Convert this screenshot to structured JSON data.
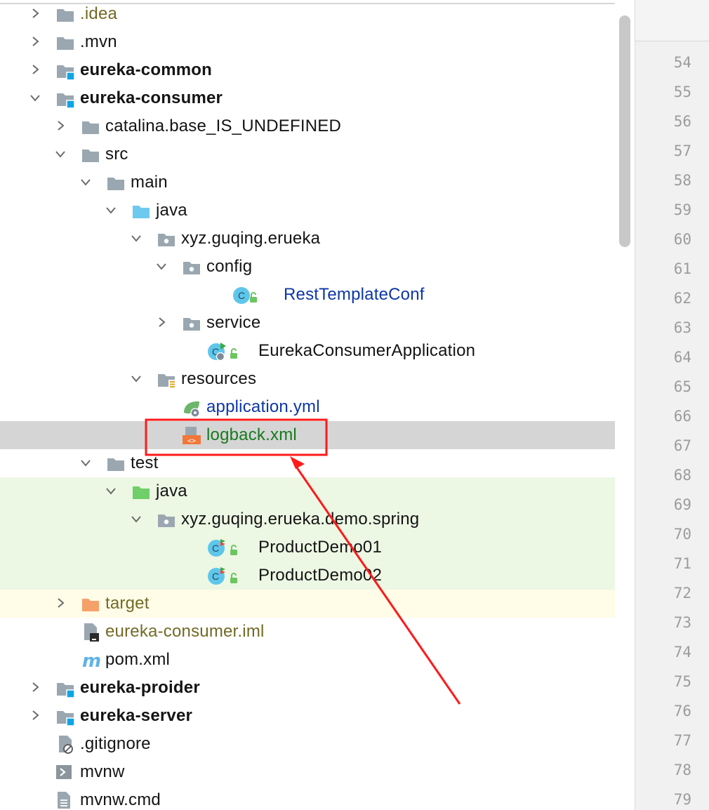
{
  "project_tree": {
    "rows": [
      {
        "label": ".idea",
        "arrow": "right",
        "icon": "folder-icon"
      },
      {
        "label": ".mvn",
        "arrow": "right",
        "icon": "folder-icon"
      },
      {
        "label": "eureka-common",
        "arrow": "right",
        "icon": "module-folder-icon"
      },
      {
        "label": "eureka-consumer",
        "arrow": "down",
        "icon": "module-folder-icon"
      },
      {
        "label": "catalina.base_IS_UNDEFINED",
        "arrow": "right",
        "icon": "folder-icon"
      },
      {
        "label": "src",
        "arrow": "down",
        "icon": "folder-icon"
      },
      {
        "label": "main",
        "arrow": "down",
        "icon": "folder-icon"
      },
      {
        "label": "java",
        "arrow": "down",
        "icon": "source-root-folder-icon"
      },
      {
        "label": "xyz.guqing.erueka",
        "arrow": "down",
        "icon": "package-icon"
      },
      {
        "label": "config",
        "arrow": "down",
        "icon": "package-icon"
      },
      {
        "label": "RestTemplateConf",
        "arrow": "none",
        "icon": "java-class-icon"
      },
      {
        "label": "service",
        "arrow": "right",
        "icon": "package-icon"
      },
      {
        "label": "EurekaConsumerApplication",
        "arrow": "none",
        "icon": "spring-boot-app-class-icon"
      },
      {
        "label": "resources",
        "arrow": "down",
        "icon": "resources-folder-icon"
      },
      {
        "label": "application.yml",
        "arrow": "none",
        "icon": "spring-config-file-icon"
      },
      {
        "label": "logback.xml",
        "arrow": "none",
        "icon": "xml-file-icon"
      },
      {
        "label": "test",
        "arrow": "down",
        "icon": "folder-icon"
      },
      {
        "label": "java",
        "arrow": "down",
        "icon": "test-root-folder-icon"
      },
      {
        "label": "xyz.guqing.erueka.demo.spring",
        "arrow": "down",
        "icon": "package-icon"
      },
      {
        "label": "ProductDemo01",
        "arrow": "none",
        "icon": "test-class-icon"
      },
      {
        "label": "ProductDemo02",
        "arrow": "none",
        "icon": "test-class-icon"
      },
      {
        "label": "target",
        "arrow": "right",
        "icon": "excluded-folder-icon"
      },
      {
        "label": "eureka-consumer.iml",
        "arrow": "none",
        "icon": "iml-file-icon"
      },
      {
        "label": "pom.xml",
        "arrow": "none",
        "icon": "maven-pom-icon"
      },
      {
        "label": "eureka-proider",
        "arrow": "right",
        "icon": "module-folder-icon"
      },
      {
        "label": "eureka-server",
        "arrow": "right",
        "icon": "module-folder-icon"
      },
      {
        "label": ".gitignore",
        "arrow": "none",
        "icon": "gitignore-file-icon"
      },
      {
        "label": "mvnw",
        "arrow": "none",
        "icon": "shell-script-icon"
      },
      {
        "label": "mvnw.cmd",
        "arrow": "none",
        "icon": "text-file-icon"
      }
    ],
    "selected_label": "logback.xml"
  },
  "gutter": {
    "line_numbers": [
      "54",
      "55",
      "56",
      "57",
      "58",
      "59",
      "60",
      "61",
      "62",
      "63",
      "64",
      "65",
      "66",
      "67",
      "68",
      "69",
      "70",
      "71",
      "72",
      "73",
      "74",
      "75",
      "76",
      "77",
      "78",
      "79"
    ]
  },
  "colors": {
    "selection": "#d5d5d5",
    "test_highlight": "#ecf7e4",
    "excluded_highlight": "#fffde8",
    "annotation_red": "#ff1a1a"
  }
}
